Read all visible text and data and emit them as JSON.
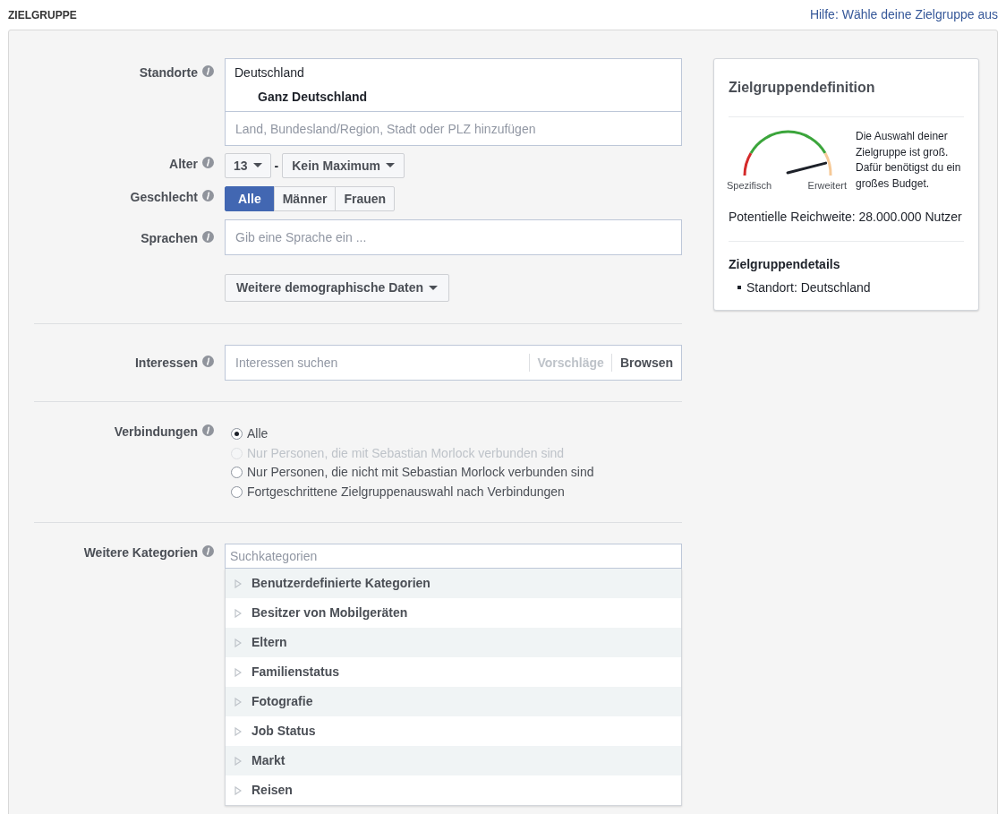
{
  "section_title": "ZIELGRUPPE",
  "help_link": "Hilfe: Wähle deine Zielgruppe aus",
  "locations": {
    "label": "Standorte",
    "country": "Deutschland",
    "scope": "Ganz Deutschland",
    "placeholder": "Land, Bundesland/Region, Stadt oder PLZ hinzufügen"
  },
  "age": {
    "label": "Alter",
    "min": "13",
    "separator": "-",
    "max": "Kein Maximum"
  },
  "gender": {
    "label": "Geschlecht",
    "options": [
      {
        "label": "Alle",
        "selected": true
      },
      {
        "label": "Männer",
        "selected": false
      },
      {
        "label": "Frauen",
        "selected": false
      }
    ]
  },
  "languages": {
    "label": "Sprachen",
    "placeholder": "Gib eine Sprache ein ..."
  },
  "more_demographics_button": "Weitere demographische Daten",
  "interests": {
    "label": "Interessen",
    "placeholder": "Interessen suchen",
    "suggestions": "Vorschläge",
    "browse": "Browsen"
  },
  "connections": {
    "label": "Verbindungen",
    "options": [
      {
        "label": "Alle",
        "selected": true,
        "disabled": false
      },
      {
        "label": "Nur Personen, die mit Sebastian Morlock verbunden sind",
        "selected": false,
        "disabled": true
      },
      {
        "label": "Nur Personen, die nicht mit Sebastian Morlock verbunden sind",
        "selected": false,
        "disabled": false
      },
      {
        "label": "Fortgeschrittene Zielgruppenauswahl nach Verbindungen",
        "selected": false,
        "disabled": false
      }
    ]
  },
  "categories": {
    "label": "Weitere Kategorien",
    "placeholder": "Suchkategorien",
    "items": [
      {
        "label": "Benutzerdefinierte Kategorien"
      },
      {
        "label": "Besitzer von Mobilgeräten"
      },
      {
        "label": "Eltern"
      },
      {
        "label": "Familienstatus"
      },
      {
        "label": "Fotografie"
      },
      {
        "label": "Job Status"
      },
      {
        "label": "Markt"
      },
      {
        "label": "Reisen"
      }
    ]
  },
  "audience_card": {
    "title": "Zielgruppendefinition",
    "gauge": {
      "low_label": "Spezifisch",
      "high_label": "Erweitert"
    },
    "gauge_text": "Die Auswahl deiner Zielgruppe ist groß. Dafür benötigst du ein großes Budget.",
    "reach": "Potentielle Reichweite: 28.000.000 Nutzer",
    "details_title": "Zielgruppendetails",
    "details": [
      "Standort: Deutschland"
    ]
  }
}
